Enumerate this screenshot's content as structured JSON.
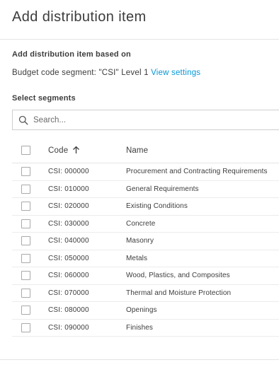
{
  "dialog": {
    "title": "Add distribution item"
  },
  "basis": {
    "label": "Add distribution item based on",
    "budget_text": "Budget code segment: \"CSI\" Level 1",
    "view_settings_label": "View settings"
  },
  "segments": {
    "label": "Select segments",
    "search_placeholder": "Search...",
    "search_value": ""
  },
  "table": {
    "columns": {
      "code": "Code",
      "name": "Name"
    },
    "sort": {
      "column": "code",
      "direction": "ascending",
      "icon": "arrow-up-icon"
    },
    "rows": [
      {
        "code": "CSI: 000000",
        "name": "Procurement and Contracting Requirements",
        "checked": false
      },
      {
        "code": "CSI: 010000",
        "name": "General Requirements",
        "checked": false
      },
      {
        "code": "CSI: 020000",
        "name": "Existing Conditions",
        "checked": false
      },
      {
        "code": "CSI: 030000",
        "name": "Concrete",
        "checked": false
      },
      {
        "code": "CSI: 040000",
        "name": "Masonry",
        "checked": false
      },
      {
        "code": "CSI: 050000",
        "name": "Metals",
        "checked": false
      },
      {
        "code": "CSI: 060000",
        "name": "Wood, Plastics, and Composites",
        "checked": false
      },
      {
        "code": "CSI: 070000",
        "name": "Thermal and Moisture Protection",
        "checked": false
      },
      {
        "code": "CSI: 080000",
        "name": "Openings",
        "checked": false
      },
      {
        "code": "CSI: 090000",
        "name": "Finishes",
        "checked": false
      }
    ]
  },
  "colors": {
    "link": "#0696d7",
    "text": "#3c3c3c",
    "border": "#cfcfcf"
  }
}
